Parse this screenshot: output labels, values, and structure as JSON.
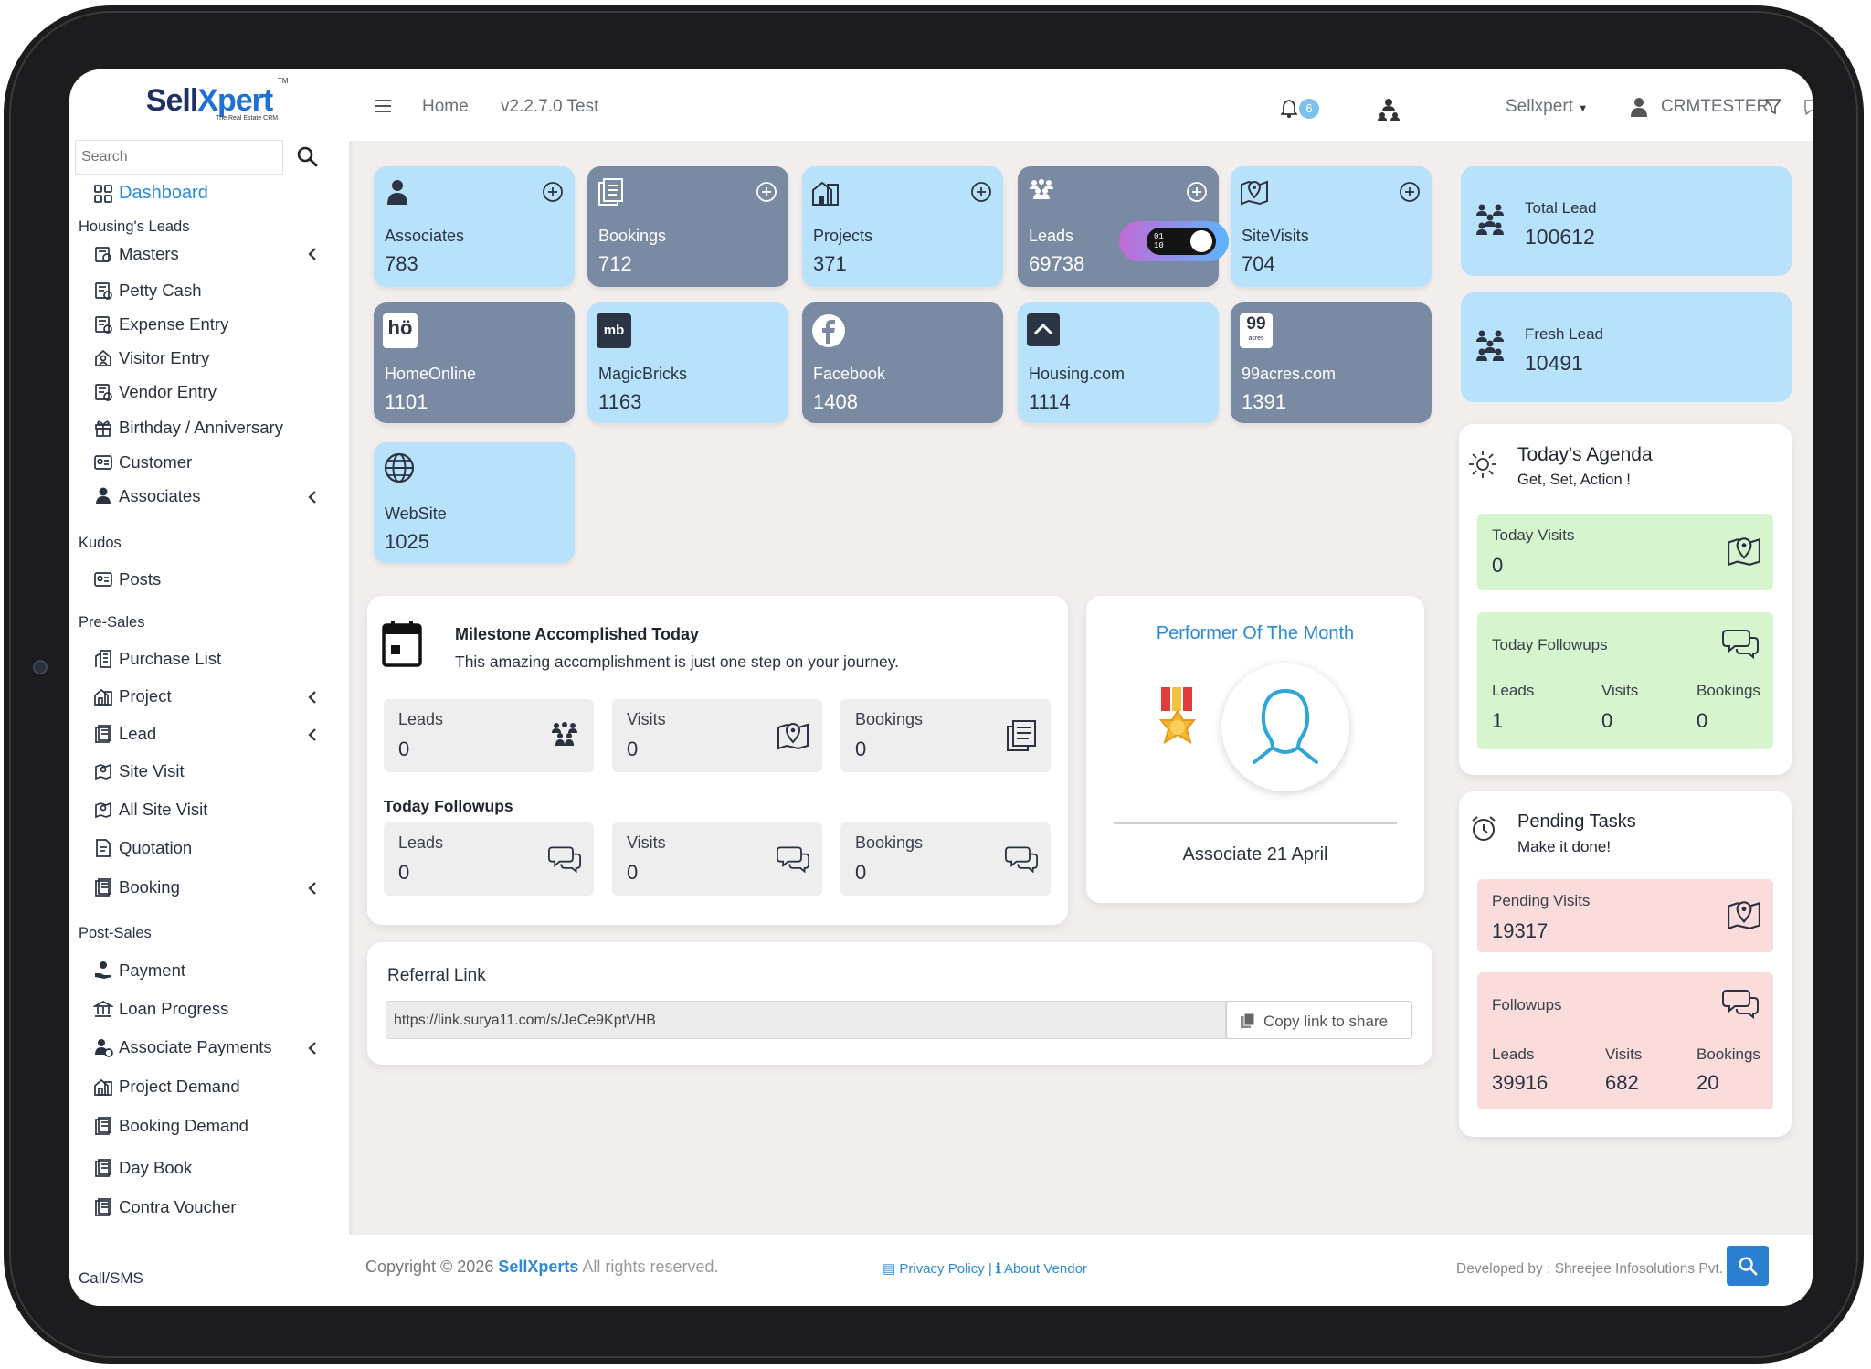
{
  "brand": {
    "logo_text": "Sell",
    "logo_x": "X",
    "logo_rest": "pert",
    "logo_tm": "TM",
    "tagline": "The Real Estate CRM"
  },
  "search": {
    "placeholder": "Search"
  },
  "sidebar": {
    "dashboard": "Dashboard",
    "section_housing": "Housing's Leads",
    "masters": "Masters",
    "petty_cash": "Petty Cash",
    "expense_entry": "Expense Entry",
    "visitor_entry": "Visitor Entry",
    "vendor_entry": "Vendor Entry",
    "birthday": "Birthday / Anniversary",
    "customer": "Customer",
    "associates": "Associates",
    "section_kudos": "Kudos",
    "posts": "Posts",
    "section_presales": "Pre-Sales",
    "purchase_list": "Purchase List",
    "project": "Project",
    "lead": "Lead",
    "site_visit": "Site Visit",
    "all_site_visit": "All Site Visit",
    "quotation": "Quotation",
    "booking": "Booking",
    "section_postsales": "Post-Sales",
    "payment": "Payment",
    "loan_progress": "Loan Progress",
    "associate_payments": "Associate Payments",
    "project_demand": "Project Demand",
    "booking_demand": "Booking Demand",
    "day_book": "Day Book",
    "contra_voucher": "Contra Voucher",
    "section_callsms": "Call/SMS"
  },
  "topbar": {
    "home": "Home",
    "version": "v2.2.7.0 Test",
    "notifications": "6",
    "company": "Sellxpert",
    "user": "CRMTESTER"
  },
  "tiles": {
    "associates": {
      "label": "Associates",
      "value": "783"
    },
    "bookings": {
      "label": "Bookings",
      "value": "712"
    },
    "projects": {
      "label": "Projects",
      "value": "371"
    },
    "leads": {
      "label": "Leads",
      "value": "69738"
    },
    "sitevisits": {
      "label": "SiteVisits",
      "value": "704"
    },
    "homeonline": {
      "label": "HomeOnline",
      "value": "1101",
      "icon_text": "hö"
    },
    "magicbricks": {
      "label": "MagicBricks",
      "value": "1163",
      "icon_text": "mb"
    },
    "facebook": {
      "label": "Facebook",
      "value": "1408"
    },
    "housing": {
      "label": "Housing.com",
      "value": "1114"
    },
    "acres": {
      "label": "99acres.com",
      "value": "1391",
      "icon_text": "99",
      "icon_sub": "acres"
    },
    "website": {
      "label": "WebSite",
      "value": "1025"
    }
  },
  "toggle": {
    "digits_top": "01",
    "digits_bottom": "10"
  },
  "milestone": {
    "title": "Milestone Accomplished Today",
    "subtitle": "This amazing accomplishment is just one step on your journey.",
    "leads_label": "Leads",
    "leads_value": "0",
    "visits_label": "Visits",
    "visits_value": "0",
    "bookings_label": "Bookings",
    "bookings_value": "0",
    "followups_title": "Today Followups",
    "f_leads_label": "Leads",
    "f_leads_value": "0",
    "f_visits_label": "Visits",
    "f_visits_value": "0",
    "f_bookings_label": "Bookings",
    "f_bookings_value": "0"
  },
  "performer": {
    "title": "Performer Of The Month",
    "name": "Associate 21 April"
  },
  "referral": {
    "title": "Referral Link",
    "url": "https://link.surya11.com/s/JeCe9KptVHB",
    "copy_label": "Copy link to share"
  },
  "right": {
    "total_lead_label": "Total Lead",
    "total_lead_value": "100612",
    "fresh_lead_label": "Fresh Lead",
    "fresh_lead_value": "10491",
    "agenda_title": "Today's Agenda",
    "agenda_subtitle": "Get, Set, Action !",
    "today_visits_label": "Today Visits",
    "today_visits_value": "0",
    "today_followups_label": "Today Followups",
    "tf_leads_label": "Leads",
    "tf_leads_value": "1",
    "tf_visits_label": "Visits",
    "tf_visits_value": "0",
    "tf_bookings_label": "Bookings",
    "tf_bookings_value": "0",
    "pending_title": "Pending Tasks",
    "pending_subtitle": "Make it done!",
    "pending_visits_label": "Pending Visits",
    "pending_visits_value": "19317",
    "followups_label": "Followups",
    "pf_leads_label": "Leads",
    "pf_leads_value": "39916",
    "pf_visits_label": "Visits",
    "pf_visits_value": "682",
    "pf_bookings_label": "Bookings",
    "pf_bookings_value": "20"
  },
  "footer": {
    "copyright": "Copyright © 2026",
    "brand": "SellXperts",
    "rights": "All rights reserved.",
    "privacy": "Privacy Policy |",
    "about": "About Vendor",
    "developed": "Developed by : Shreejee Infosolutions Pvt. Ltd."
  },
  "colors": {
    "accent": "#2a8ad8",
    "tile_light": "#b8e2fb",
    "tile_dark": "#7a8aa3",
    "green_box": "#d6f5cf",
    "red_box": "#fadcdc"
  }
}
